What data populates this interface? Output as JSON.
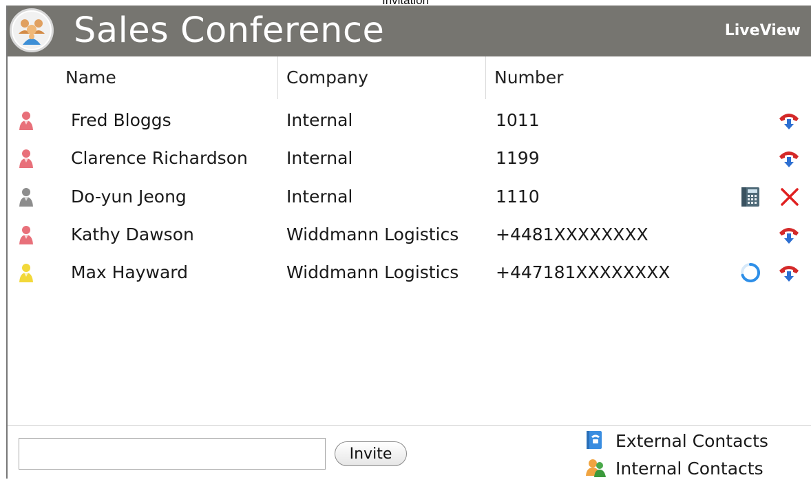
{
  "caption": "Invitation",
  "header": {
    "title": "Sales Conference",
    "liveview_label": "LiveView",
    "logo_icon": "conference-group-icon"
  },
  "columns": {
    "name": "Name",
    "company": "Company",
    "number": "Number"
  },
  "participants": [
    {
      "name": "Fred Bloggs",
      "company": "Internal",
      "number": "1011",
      "status": "connected",
      "status_color": "#e8707a",
      "actions": [
        "hangup-icon"
      ]
    },
    {
      "name": "Clarence Richardson",
      "company": "Internal",
      "number": "1199",
      "status": "connected",
      "status_color": "#e8707a",
      "actions": [
        "hangup-icon"
      ]
    },
    {
      "name": "Do-yun Jeong",
      "company": "Internal",
      "number": "1110",
      "status": "idle",
      "status_color": "#8d8d8d",
      "actions": [
        "dialpad-icon",
        "remove-icon"
      ]
    },
    {
      "name": "Kathy Dawson",
      "company": "Widdmann Logistics",
      "number": "+4481XXXXXXXX",
      "status": "connected",
      "status_color": "#e8707a",
      "actions": [
        "hangup-icon"
      ]
    },
    {
      "name": "Max Hayward",
      "company": "Widdmann Logistics",
      "number": "+447181XXXXXXXX",
      "status": "ringing",
      "status_color": "#f2d83a",
      "actions": [
        "loading-spinner-icon",
        "hangup-icon"
      ]
    }
  ],
  "footer": {
    "invite_value": "",
    "invite_button": "Invite",
    "external_contacts": "External Contacts",
    "internal_contacts": "Internal Contacts"
  },
  "colors": {
    "titlebar": "#767570",
    "hangup_red": "#d42a2a",
    "remove_red": "#e02020",
    "spinner_blue": "#2e8fe8"
  }
}
